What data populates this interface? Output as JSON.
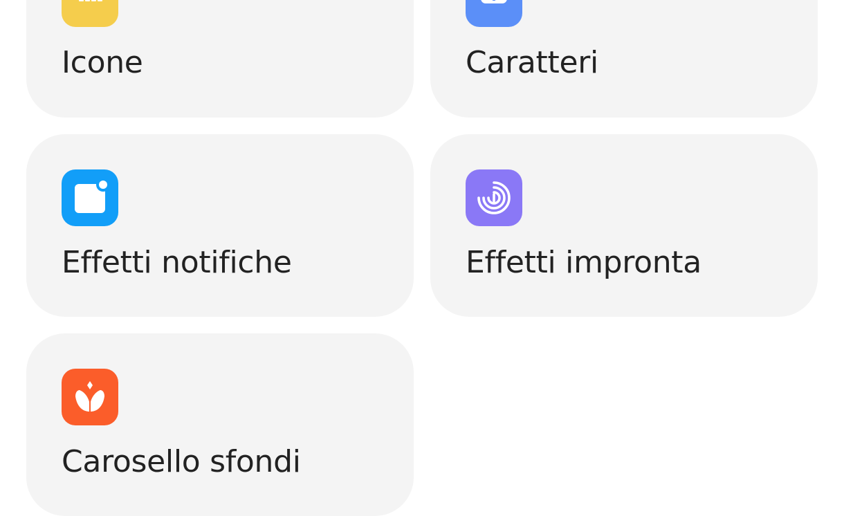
{
  "cards": {
    "icons": {
      "label": "Icone",
      "icon": "app-grid-icon",
      "color": "#f5cd4c"
    },
    "fonts": {
      "label": "Caratteri",
      "icon": "font-icon",
      "color": "#5b8ff8"
    },
    "notifications": {
      "label": "Effetti notifiche",
      "icon": "notification-icon",
      "color": "#129ef8"
    },
    "fingerprint": {
      "label": "Effetti impronta",
      "icon": "fingerprint-icon",
      "color": "#8a78f6"
    },
    "carousel": {
      "label": "Carosello sfondi",
      "icon": "tulip-icon",
      "color": "#fb5d2a"
    }
  },
  "colors": {
    "card_background": "#f4f4f4",
    "page_background": "#ffffff",
    "text": "#222222"
  }
}
